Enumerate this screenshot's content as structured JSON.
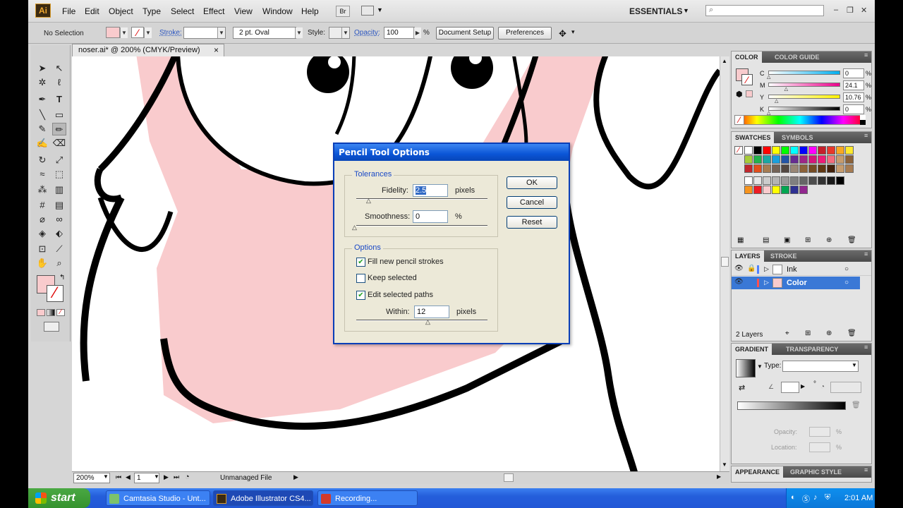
{
  "menubar": {
    "logo": "Ai",
    "items": [
      "File",
      "Edit",
      "Object",
      "Type",
      "Select",
      "Effect",
      "View",
      "Window",
      "Help"
    ],
    "workspace": "ESSENTIALS",
    "workspace_arrow": "▼"
  },
  "controlbar": {
    "selection": "No Selection",
    "stroke_label": "Stroke:",
    "brush": "2 pt. Oval",
    "style_label": "Style:",
    "opacity_label": "Opacity:",
    "opacity_value": "100",
    "opacity_unit": "%",
    "document_setup": "Document Setup",
    "preferences": "Preferences"
  },
  "document": {
    "tab_title": "noser.ai* @ 200% (CMYK/Preview)",
    "close": "×",
    "zoom": "200%",
    "page": "1",
    "status": "Unmanaged File"
  },
  "color_panel": {
    "tabs": [
      "COLOR",
      "COLOR GUIDE"
    ],
    "channels": [
      {
        "label": "C",
        "value": "0",
        "unit": "%",
        "level": 0
      },
      {
        "label": "M",
        "value": "24.1",
        "unit": "%",
        "level": 0.241
      },
      {
        "label": "Y",
        "value": "10.76",
        "unit": "%",
        "level": 0.1076
      },
      {
        "label": "K",
        "value": "0",
        "unit": "%",
        "level": 0
      }
    ],
    "fill_color": "#f9cbcd"
  },
  "swatches_panel": {
    "tabs": [
      "SWATCHES",
      "SYMBOLS"
    ],
    "row1": [
      "#ffffff",
      "#000000",
      "#ff0000",
      "#ffff00",
      "#00ff00",
      "#00ffff",
      "#0000ff",
      "#ff00ff",
      "#c61f2b",
      "#e8372b",
      "#f7a823",
      "#fde92e"
    ],
    "row2": [
      "#a7cc39",
      "#22b24c",
      "#1ba7a3",
      "#1ba0dd",
      "#2454a6",
      "#662d91",
      "#9d2687",
      "#d4177b",
      "#ed1c77",
      "#f26d7d",
      "#c69c6d",
      "#8c6239"
    ],
    "row3": [
      "#c1272d",
      "#e24e1b",
      "#a67c52",
      "#736357",
      "#534741",
      "#998675",
      "#8c6239",
      "#754c24",
      "#603813",
      "#42210b",
      "#c69c6d",
      "#a67c52"
    ],
    "row4": [
      "#ffffff",
      "#e6e6e6",
      "#cccccc",
      "#b3b3b3",
      "#999999",
      "#808080",
      "#666666",
      "#4d4d4d",
      "#333333",
      "#1a1a1a",
      "#000000"
    ],
    "row5": [
      "#f7941d",
      "#ed1c24",
      "#f9cbcd",
      "#ffff00",
      "#00a651",
      "#2e3192",
      "#92278f"
    ]
  },
  "layers_panel": {
    "tabs": [
      "LAYERS",
      "STROKE"
    ],
    "layers": [
      {
        "name": "Ink",
        "color": "#4f81ff"
      },
      {
        "name": "Color",
        "color": "#ff4f4f"
      }
    ],
    "count": "2 Layers"
  },
  "gradient_panel": {
    "tabs": [
      "GRADIENT",
      "TRANSPARENCY"
    ],
    "type_label": "Type:",
    "degree": "°",
    "opacity_label": "Opacity:",
    "location_label": "Location:",
    "percent": "%"
  },
  "appearance_panel": {
    "tabs": [
      "APPEARANCE",
      "GRAPHIC STYLE"
    ]
  },
  "dialog": {
    "title": "Pencil Tool Options",
    "tolerances_label": "Tolerances",
    "fidelity_label": "Fidelity:",
    "fidelity_value": "2.5",
    "fidelity_unit": "pixels",
    "smoothness_label": "Smoothness:",
    "smoothness_value": "0",
    "smoothness_unit": "%",
    "options_label": "Options",
    "fill_new_label": "Fill new pencil strokes",
    "fill_new_checked": true,
    "keep_selected_label": "Keep selected",
    "keep_selected_checked": false,
    "edit_selected_label": "Edit selected paths",
    "edit_selected_checked": true,
    "within_label": "Within:",
    "within_value": "12",
    "within_unit": "pixels",
    "ok": "OK",
    "cancel": "Cancel",
    "reset": "Reset"
  },
  "taskbar": {
    "start": "start",
    "tasks": [
      "Camtasia Studio - Unt...",
      "Adobe Illustrator CS4...",
      "Recording..."
    ],
    "clock": "2:01 AM"
  }
}
